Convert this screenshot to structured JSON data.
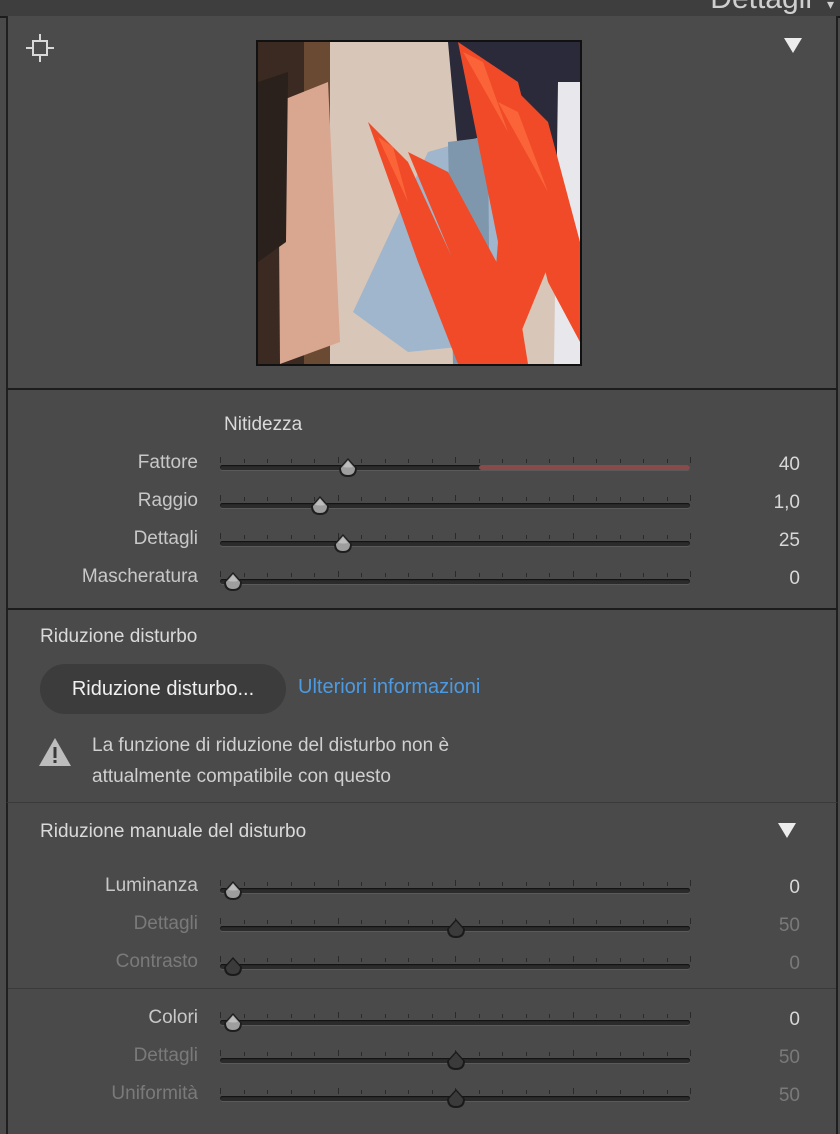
{
  "header": {
    "title": "Dettagli"
  },
  "sharpening": {
    "title": "Nitidezza",
    "sliders": [
      {
        "label": "Fattore",
        "value": "40",
        "pos": 0.27,
        "enabled": true
      },
      {
        "label": "Raggio",
        "value": "1,0",
        "pos": 0.21,
        "enabled": true
      },
      {
        "label": "Dettagli",
        "value": "25",
        "pos": 0.26,
        "enabled": true
      },
      {
        "label": "Mascheratura",
        "value": "0",
        "pos": 0.025,
        "enabled": true
      }
    ]
  },
  "noise": {
    "title": "Riduzione disturbo",
    "button_label": "Riduzione disturbo...",
    "link_label": "Ulteriori informazioni",
    "warning_line1": "La funzione di riduzione del disturbo non è",
    "warning_line2": "attualmente compatibile con questo"
  },
  "manual": {
    "title": "Riduzione manuale del disturbo",
    "luminance": [
      {
        "label": "Luminanza",
        "value": "0",
        "pos": 0.025,
        "enabled": true
      },
      {
        "label": "Dettagli",
        "value": "50",
        "pos": 0.5,
        "enabled": false
      },
      {
        "label": "Contrasto",
        "value": "0",
        "pos": 0.025,
        "enabled": false
      }
    ],
    "color": [
      {
        "label": "Colori",
        "value": "0",
        "pos": 0.025,
        "enabled": true
      },
      {
        "label": "Dettagli",
        "value": "50",
        "pos": 0.5,
        "enabled": false
      },
      {
        "label": "Uniformità",
        "value": "50",
        "pos": 0.5,
        "enabled": false
      }
    ]
  },
  "icons": {
    "target": "target-adjust-icon",
    "collapse": "triangle-down-icon",
    "warning": "warning-icon"
  },
  "colors": {
    "link": "#4c9be2",
    "accent_red": "#8a4a4a"
  }
}
